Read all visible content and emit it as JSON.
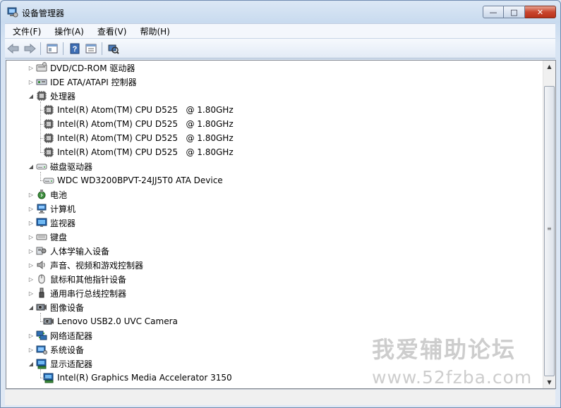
{
  "window": {
    "title": "设备管理器"
  },
  "caption_buttons": {
    "minimize": "—",
    "maximize": "□",
    "close": "✕"
  },
  "menu": [
    {
      "label": "文件(F)"
    },
    {
      "label": "操作(A)"
    },
    {
      "label": "查看(V)"
    },
    {
      "label": "帮助(H)"
    }
  ],
  "toolbar_icons": [
    "back-icon",
    "forward-icon",
    "show-hide-tree-icon",
    "help-icon",
    "properties-icon",
    "scan-hardware-icon"
  ],
  "tree": [
    {
      "label": "DVD/CD-ROM 驱动器",
      "level": 0,
      "state": "collapsed",
      "icon": "dvd-drive-icon"
    },
    {
      "label": "IDE ATA/ATAPI 控制器",
      "level": 0,
      "state": "collapsed",
      "icon": "ide-controller-icon"
    },
    {
      "label": "处理器",
      "level": 0,
      "state": "expanded",
      "icon": "processor-icon"
    },
    {
      "label": "Intel(R) Atom(TM) CPU D525   @ 1.80GHz",
      "level": 1,
      "icon": "processor-icon"
    },
    {
      "label": "Intel(R) Atom(TM) CPU D525   @ 1.80GHz",
      "level": 1,
      "icon": "processor-icon"
    },
    {
      "label": "Intel(R) Atom(TM) CPU D525   @ 1.80GHz",
      "level": 1,
      "icon": "processor-icon"
    },
    {
      "label": "Intel(R) Atom(TM) CPU D525   @ 1.80GHz",
      "level": 1,
      "icon": "processor-icon"
    },
    {
      "label": "磁盘驱动器",
      "level": 0,
      "state": "expanded",
      "icon": "disk-drive-icon"
    },
    {
      "label": "WDC WD3200BPVT-24JJ5T0 ATA Device",
      "level": 1,
      "icon": "disk-drive-icon"
    },
    {
      "label": "电池",
      "level": 0,
      "state": "collapsed",
      "icon": "battery-icon"
    },
    {
      "label": "计算机",
      "level": 0,
      "state": "collapsed",
      "icon": "computer-icon"
    },
    {
      "label": "监视器",
      "level": 0,
      "state": "collapsed",
      "icon": "monitor-icon"
    },
    {
      "label": "键盘",
      "level": 0,
      "state": "collapsed",
      "icon": "keyboard-icon"
    },
    {
      "label": "人体学输入设备",
      "level": 0,
      "state": "collapsed",
      "icon": "hid-icon"
    },
    {
      "label": "声音、视频和游戏控制器",
      "level": 0,
      "state": "collapsed",
      "icon": "speaker-icon"
    },
    {
      "label": "鼠标和其他指针设备",
      "level": 0,
      "state": "collapsed",
      "icon": "mouse-icon"
    },
    {
      "label": "通用串行总线控制器",
      "level": 0,
      "state": "collapsed",
      "icon": "usb-icon"
    },
    {
      "label": "图像设备",
      "level": 0,
      "state": "expanded",
      "icon": "camera-icon"
    },
    {
      "label": "Lenovo USB2.0 UVC Camera",
      "level": 1,
      "icon": "camera-icon"
    },
    {
      "label": "网络适配器",
      "level": 0,
      "state": "collapsed",
      "icon": "network-adapter-icon"
    },
    {
      "label": "系统设备",
      "level": 0,
      "state": "collapsed",
      "icon": "system-device-icon"
    },
    {
      "label": "显示适配器",
      "level": 0,
      "state": "expanded",
      "icon": "display-adapter-icon"
    },
    {
      "label": "Intel(R) Graphics Media Accelerator 3150",
      "level": 1,
      "icon": "display-adapter-icon"
    }
  ],
  "scrollbar": {
    "up": "▲",
    "down": "▼",
    "grip": "≡"
  },
  "watermark": {
    "line1": "我爱辅助论坛",
    "line2": "www.52fzba.com"
  },
  "colors": {
    "accent": "#6f8bb0",
    "close": "#c9452e"
  }
}
